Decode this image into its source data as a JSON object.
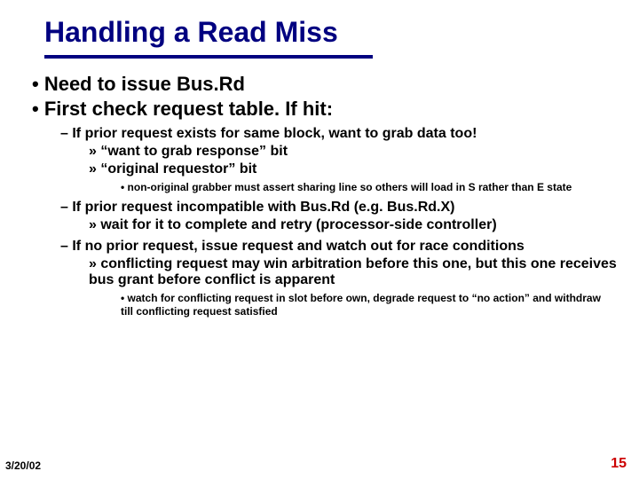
{
  "title": "Handling a Read Miss",
  "bullets": {
    "l1a": "Need to issue Bus.Rd",
    "l1b": "First check request table.  If hit:",
    "l2a": "If prior request exists for same block, want to grab data too!",
    "l3a": "“want to grab response” bit",
    "l3b": "“original requestor”  bit",
    "l4a": "non-original grabber must assert sharing line so others will load in S rather than E state",
    "l2b": "If prior request incompatible with Bus.Rd (e.g. Bus.Rd.X)",
    "l3c": "wait for it to complete and retry (processor-side controller)",
    "l2c": "If no prior request, issue request and watch out for race conditions",
    "l3d": "conflicting request may win arbitration before this one, but this one receives bus grant before conflict is apparent",
    "l4b": "watch for conflicting request in slot before own, degrade request to “no action” and withdraw till conflicting request satisfied"
  },
  "footer": {
    "date": "3/20/02",
    "page": "15"
  }
}
